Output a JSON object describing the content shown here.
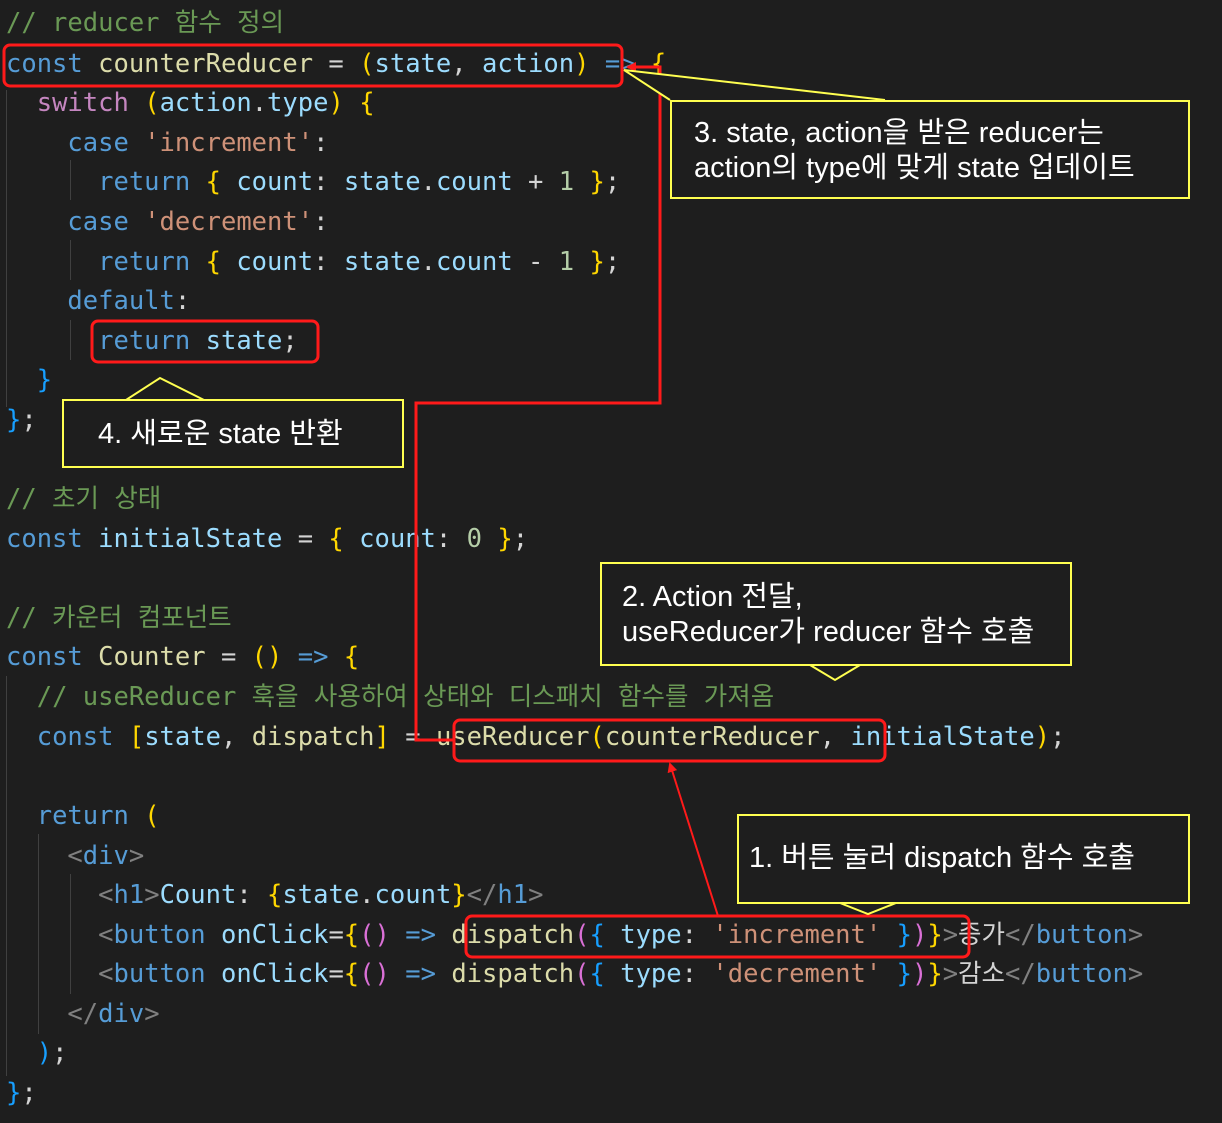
{
  "code": {
    "lines": [
      "// reducer 함수 정의",
      "const counterReducer = (state, action) => {",
      "  switch (action.type) {",
      "    case 'increment':",
      "      return { count: state.count + 1 };",
      "    case 'decrement':",
      "      return { count: state.count - 1 };",
      "    default:",
      "      return state;",
      "  }",
      "};",
      "",
      "// 초기 상태",
      "const initialState = { count: 0 };",
      "",
      "// 카운터 컴포넌트",
      "const Counter = () => {",
      "  // useReducer 훅을 사용하여 상태와 디스패치 함수를 가져옴",
      "  const [state, dispatch] = useReducer(counterReducer, initialState);",
      "",
      "  return (",
      "    <div>",
      "      <h1>Count: {state.count}</h1>",
      "      <button onClick={() => dispatch({ type: 'increment' })}>증가</button>",
      "      <button onClick={() => dispatch({ type: 'decrement' })}>감소</button>",
      "    </div>",
      "  );",
      "};"
    ]
  },
  "callouts": {
    "step1": [
      "1. 버튼 눌러 dispatch 함수 호출"
    ],
    "step2": [
      "2. Action 전달,",
      "useReducer가 reducer 함수 호출"
    ],
    "step3": [
      "3. state, action을 받은 reducer는",
      "action의 type에 맞게 state 업데이트"
    ],
    "step4": [
      "4. 새로운 state 반환"
    ]
  },
  "colors": {
    "background": "#1e1e1e",
    "highlight_box": "#ff1a1a",
    "callout_border": "#ffff50",
    "callout_text": "#ffffff"
  }
}
